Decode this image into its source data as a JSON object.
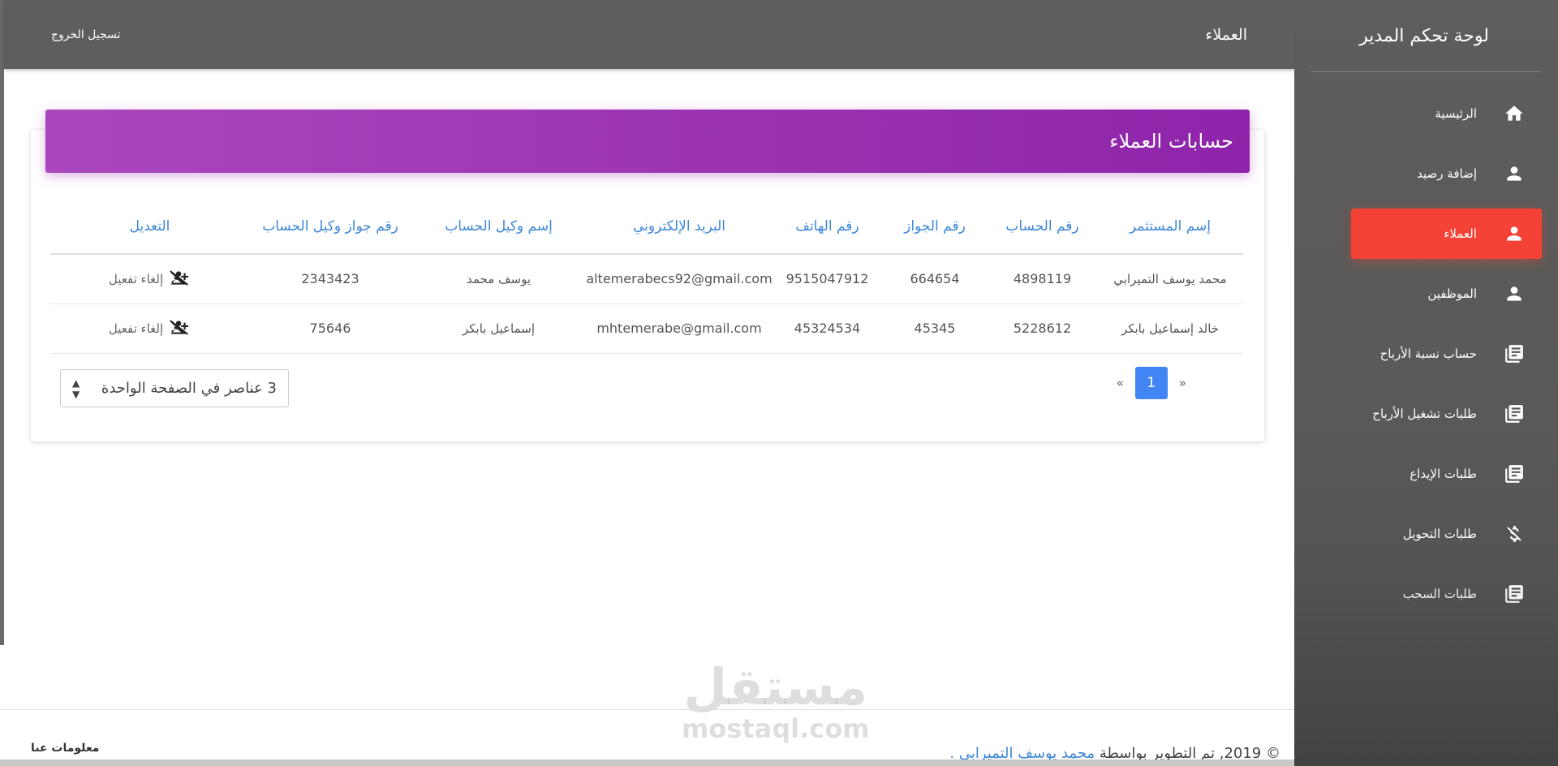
{
  "brand": {
    "title": "لوحة تحكم المدير"
  },
  "sidebar": {
    "items": [
      {
        "label": "الرئيسية",
        "icon": "home-icon",
        "active": false
      },
      {
        "label": "إضافة رصيد",
        "icon": "person-icon",
        "active": false
      },
      {
        "label": "العملاء",
        "icon": "person-icon",
        "active": true
      },
      {
        "label": "الموظفين",
        "icon": "person-icon",
        "active": false
      },
      {
        "label": "حساب نسبة الأرباح",
        "icon": "library-books-icon",
        "active": false
      },
      {
        "label": "طلبات تشغيل الأرباح",
        "icon": "library-books-icon",
        "active": false
      },
      {
        "label": "طلبات الإيداع",
        "icon": "library-books-icon",
        "active": false
      },
      {
        "label": "طلبات التحويل",
        "icon": "money-off-icon",
        "active": false
      },
      {
        "label": "طلبات السحب",
        "icon": "library-books-icon",
        "active": false
      }
    ]
  },
  "topbar": {
    "title": "العملاء",
    "logout_label": "تسجيل الخروج"
  },
  "card": {
    "title": "حسابات العملاء",
    "columns": [
      "إسم المستثمر",
      "رقم الحساب",
      "رقم الجواز",
      "رقم الهاتف",
      "البريد الإلكتروني",
      "إسم وكيل الحساب",
      "رقم جواز وكيل الحساب",
      "التعديل"
    ],
    "rows": [
      {
        "name": "محمد يوسف التميرابي",
        "account": "4898119",
        "passport": "664654",
        "phone": "9515047912",
        "email": "altemerabecs92@gmail.com",
        "agent_name": "يوسف محمد",
        "agent_passport": "2343423",
        "action": "إلغاء تفعيل"
      },
      {
        "name": "خالد إسماعيل بابكر",
        "account": "5228612",
        "passport": "45345",
        "phone": "45324534",
        "email": "mhtemerabe@gmail.com",
        "agent_name": "إسماعيل بابكر",
        "agent_passport": "75646",
        "action": "إلغاء تفعيل"
      }
    ],
    "pagination": {
      "prev": "«",
      "current": "1",
      "next": "»"
    },
    "per_page": "3 عناصر في الصفحة الواحدة"
  },
  "footer": {
    "about": "معلومات عنا",
    "copy_prefix": "© 2019, تم التطوير بواسطة",
    "author": "محمد يوسف التميرابي",
    "copy_suffix": "."
  },
  "watermark": {
    "arabic": "مستقل",
    "latin": "mostaql.com"
  },
  "colors": {
    "accent": "#f44336",
    "header_purple": "#9c27b0",
    "link_blue": "#3d86d8",
    "sidebar": "#5e5d5b"
  }
}
